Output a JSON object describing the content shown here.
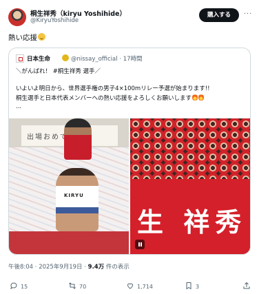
{
  "header": {
    "display_name": "桐生祥秀（kiryu Yoshihide）",
    "handle": "@KiryuYoshihide",
    "buy_label": "購入する",
    "more_label": "···"
  },
  "tweet": {
    "text": "熱い応援"
  },
  "quote": {
    "name": "日本生命",
    "handle_time": "@nissay_official · 17時間",
    "lines": [
      "＼がんばれ！ #桐生祥秀 選手／",
      "いよいよ明日から、世界選手権の男子4×100mリレー予選が始まります!!",
      "桐生選手と日本代表メンバーへの熱い応援をよろしくお願いします",
      "..."
    ],
    "images": {
      "left_banner_text": "出場おめでとう",
      "runner_bib": "KIRYU",
      "right_banner_text": "生 祥秀"
    }
  },
  "meta": {
    "time": "午後8:04 · 2025年9月19日 · ",
    "views": "9.4万",
    "views_suffix": " 件の表示"
  },
  "actions": {
    "reply_count": "15",
    "repost_count": "70",
    "like_count": "1,714",
    "bookmark_count": "3"
  }
}
